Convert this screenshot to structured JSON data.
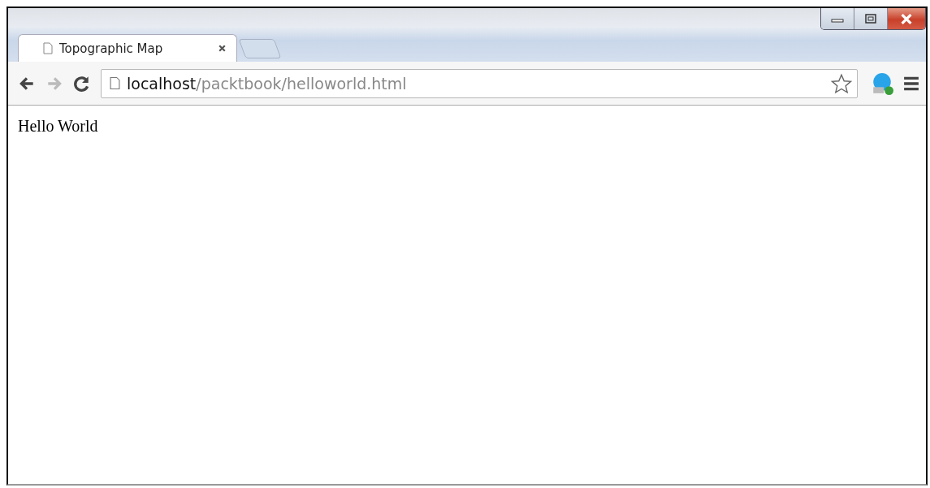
{
  "window": {
    "buttons": [
      {
        "kind": "minimize"
      },
      {
        "kind": "maximize"
      },
      {
        "kind": "close"
      }
    ]
  },
  "tabs": [
    {
      "title": "Topographic Map",
      "selected": true
    }
  ],
  "address_bar": {
    "host": "localhost",
    "path": "/packtbook/helloworld.html",
    "bookmarked": false
  },
  "page": {
    "text": "Hello World"
  }
}
